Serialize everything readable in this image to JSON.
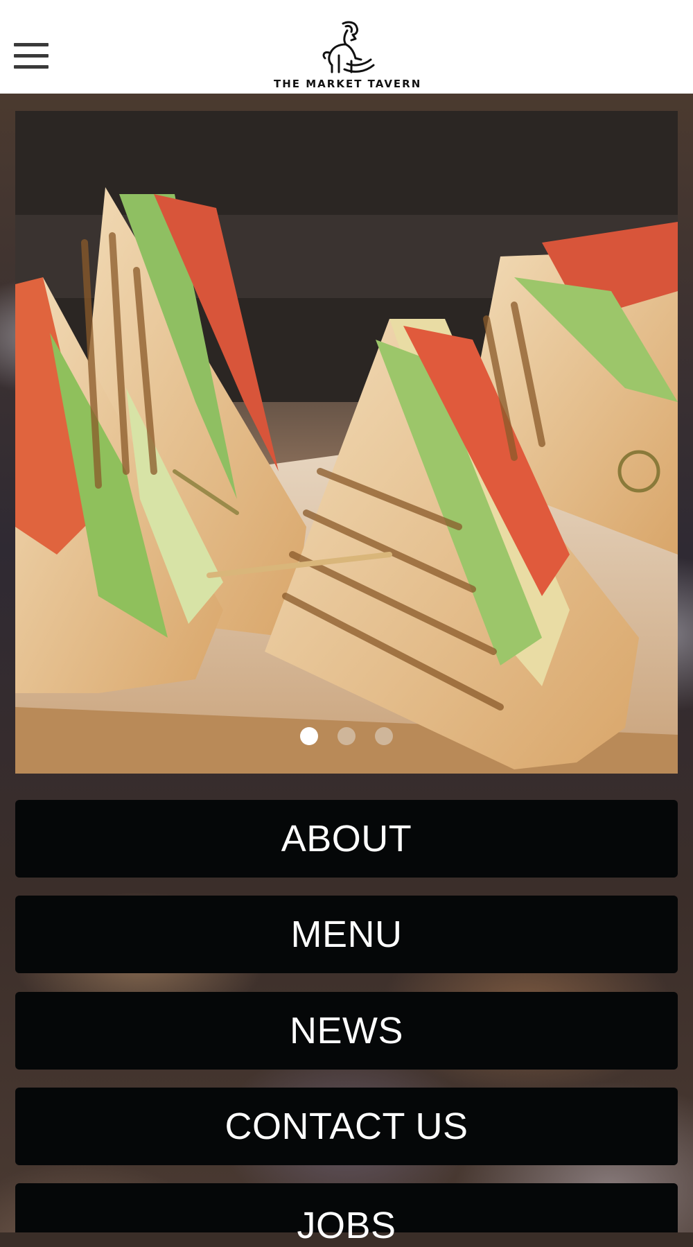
{
  "header": {
    "menu_icon": "hamburger-icon",
    "logo_text": "THE MARKET TAVERN",
    "logo_icon": "goat-logo-icon"
  },
  "slider": {
    "image_description": "grilled-sandwich-photo",
    "slide_count": 3,
    "active_slide": 1
  },
  "nav": {
    "about": "ABOUT",
    "menu": "MENU",
    "news": "NEWS",
    "contact": "CONTACT US",
    "jobs": "JOBS"
  },
  "colors": {
    "header_bg": "#ffffff",
    "button_bg": "#050708",
    "button_text": "#ffffff"
  }
}
